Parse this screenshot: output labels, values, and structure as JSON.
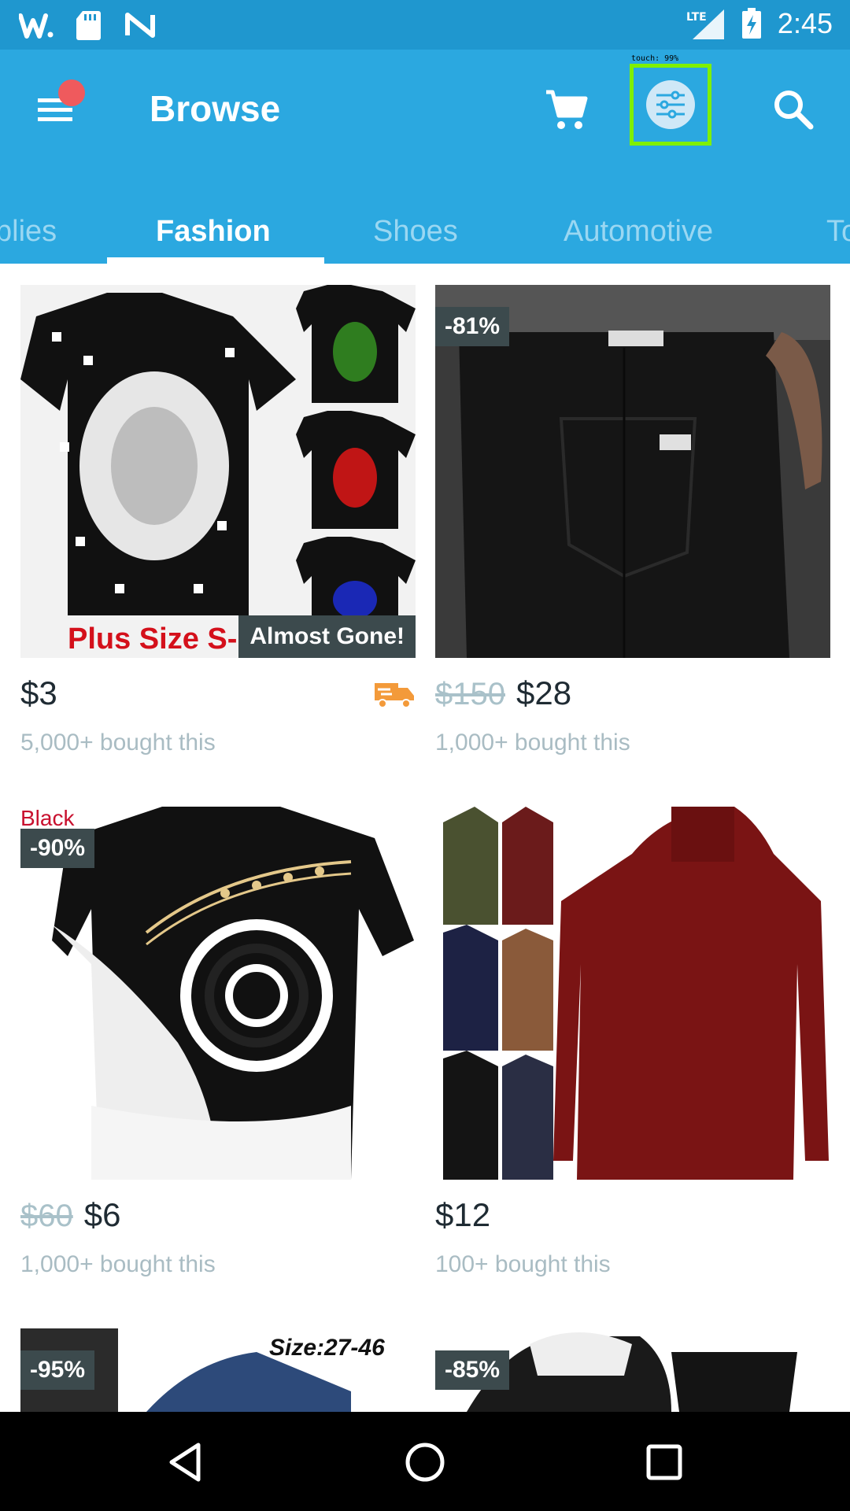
{
  "status_bar": {
    "time": "2:45",
    "network": "LTE"
  },
  "header": {
    "title": "Browse",
    "touch_label": "touch: 99%"
  },
  "tabs": [
    {
      "label": "plies"
    },
    {
      "label": "Fashion",
      "active": true
    },
    {
      "label": "Shoes"
    },
    {
      "label": "Automotive"
    },
    {
      "label": "To"
    }
  ],
  "products": [
    {
      "price": "$3",
      "old_price": "",
      "bought": "5,000+ bought this",
      "badge": "",
      "overlay": "Almost Gone!",
      "image_text": "Plus Size S-"
    },
    {
      "price": "$28",
      "old_price": "$150",
      "bought": "1,000+ bought this",
      "badge": "-81%"
    },
    {
      "price": "$6",
      "old_price": "$60",
      "bought": "1,000+ bought this",
      "badge": "-90%",
      "color_label": "Black"
    },
    {
      "price": "$12",
      "old_price": "",
      "bought": "100+ bought this",
      "badge": ""
    },
    {
      "badge": "-95%",
      "image_text": "Size:27-46"
    },
    {
      "badge": "-85%"
    }
  ],
  "colors": {
    "appbar": "#2ba8e0",
    "statusbar": "#1f97cf",
    "badge": "#3c4a4d",
    "accent_dot": "#ef5a5d",
    "shipping": "#f39a3a"
  }
}
